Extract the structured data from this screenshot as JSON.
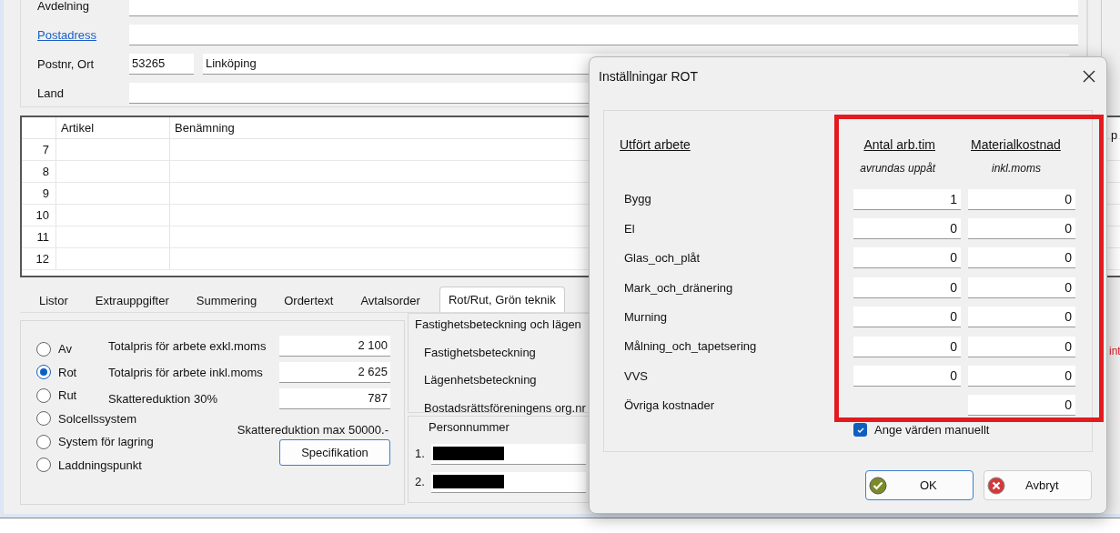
{
  "form": {
    "fields": [
      {
        "label": "Avdelning",
        "kind": "plain"
      },
      {
        "label": "Postadress",
        "kind": "link"
      },
      {
        "label": "Postnr, Ort",
        "kind": "postal",
        "values": [
          "53265",
          "Linköping"
        ]
      },
      {
        "label": "Land",
        "kind": "plain"
      }
    ]
  },
  "grid": {
    "columns": [
      "Artikel",
      "Benämning"
    ],
    "column_3": "p",
    "rows": [
      "7",
      "8",
      "9",
      "10",
      "11",
      "12"
    ]
  },
  "tabs": [
    {
      "label": "Listor",
      "selected": false
    },
    {
      "label": "Extrauppgifter",
      "selected": false
    },
    {
      "label": "Summering",
      "selected": false
    },
    {
      "label": "Ordertext",
      "selected": false
    },
    {
      "label": "Avtalsorder",
      "selected": false
    },
    {
      "label": "Rot/Rut, Grön teknik",
      "selected": true
    }
  ],
  "rot_panel": {
    "options": [
      {
        "label": "Av",
        "selected": false
      },
      {
        "label": "Rot",
        "selected": true
      },
      {
        "label": "Rut",
        "selected": false
      },
      {
        "label": "Solcellssystem",
        "selected": false
      },
      {
        "label": "System för lagring",
        "selected": false
      },
      {
        "label": "Laddningspunkt",
        "selected": false
      }
    ],
    "amounts": [
      {
        "label": "Totalpris för arbete exkl.moms",
        "value": "2 100"
      },
      {
        "label": "Totalpris för arbete inkl.moms",
        "value": "2 625"
      },
      {
        "label": "Skattereduktion 30%",
        "value": "787"
      }
    ],
    "max_note": "Skattereduktion max 50000.-",
    "button": "Specifikation"
  },
  "property_panel": {
    "title": "Fastighetsbeteckning och lägen",
    "fields": [
      "Fastighetsbeteckning",
      "Lägenhetsbeteckning",
      "Bostadsrättsföreningens org.nr"
    ]
  },
  "personnummer": {
    "title": "Personnummer",
    "rows": [
      "1.",
      "2."
    ]
  },
  "side_note": "int",
  "dialog": {
    "title": "Inställningar ROT",
    "work_header": "Utfört arbete",
    "hours_header": "Antal arb.tim",
    "material_header": "Materialkostnad",
    "hours_note": "avrundas uppåt",
    "material_note": "inkl.moms",
    "rows": [
      {
        "label": "Bygg",
        "hours": "1",
        "material": "0"
      },
      {
        "label": "El",
        "hours": "0",
        "material": "0"
      },
      {
        "label": "Glas_och_plåt",
        "hours": "0",
        "material": "0"
      },
      {
        "label": "Mark_och_dränering",
        "hours": "0",
        "material": "0"
      },
      {
        "label": "Murning",
        "hours": "0",
        "material": "0"
      },
      {
        "label": "Målning_och_tapetsering",
        "hours": "0",
        "material": "0"
      },
      {
        "label": "VVS",
        "hours": "0",
        "material": "0"
      },
      {
        "label": "Övriga kostnader",
        "material": "0"
      }
    ],
    "checkbox": {
      "label": "Ange värden manuellt",
      "checked": true
    },
    "buttons": [
      {
        "label": "OK",
        "kind": "ok"
      },
      {
        "label": "Avbryt",
        "kind": "cancel"
      }
    ]
  }
}
